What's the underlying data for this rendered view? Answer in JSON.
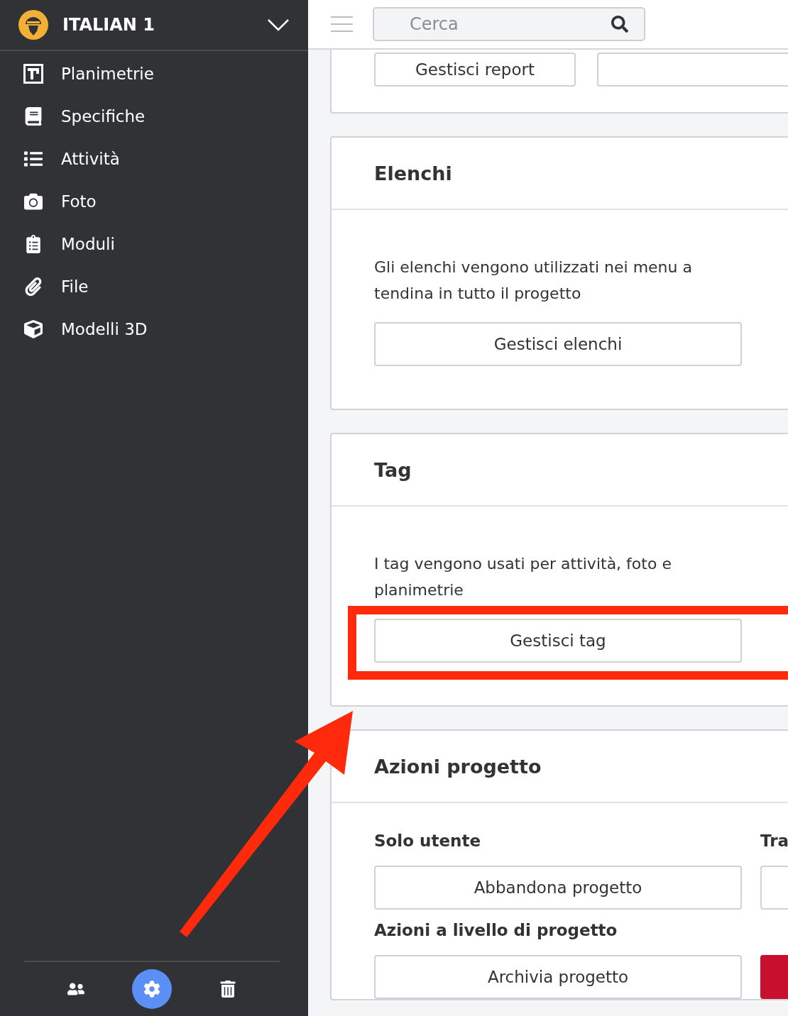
{
  "sidebar": {
    "project_title": "ITALIAN 1",
    "nav_items": [
      {
        "label": "Planimetrie"
      },
      {
        "label": "Specifiche"
      },
      {
        "label": "Attività"
      },
      {
        "label": "Foto"
      },
      {
        "label": "Moduli"
      },
      {
        "label": "File"
      },
      {
        "label": "Modelli 3D"
      }
    ],
    "footer_buttons": [
      {
        "selected": false
      },
      {
        "selected": true
      },
      {
        "selected": false
      }
    ]
  },
  "top_bar": {
    "search": {
      "placeholder": "Cerca"
    }
  },
  "sections": [
    {
      "kind": "partial",
      "buttons": [
        {
          "kind": "outline",
          "label": "Gestisci report"
        },
        {
          "kind": "outline"
        }
      ]
    },
    {
      "kind": "card",
      "title": "Elenchi",
      "description": "Gli elenchi vengono utilizzati nei menu a tendina in tutto il progetto",
      "button": "Gestisci elenchi",
      "highlighted": false
    },
    {
      "kind": "card",
      "title": "Tag",
      "description": "I tag vengono usati per attività, foto e planimetrie",
      "button": "Gestisci tag",
      "highlighted": true
    },
    {
      "kind": "actions",
      "title": "Azioni progetto",
      "groups": [
        {
          "columns": [
            {
              "heading": "Solo utente",
              "button": {
                "kind": "outline",
                "label": "Abbandona progetto"
              }
            },
            {
              "heading": "Tra",
              "button": {
                "kind": "outline"
              }
            }
          ]
        },
        {
          "columns": [
            {
              "heading": "Azioni a livello di progetto",
              "button": {
                "kind": "outline",
                "label": "Archivia progetto"
              }
            },
            {
              "button": {
                "kind": "danger"
              }
            }
          ]
        }
      ]
    }
  ]
}
